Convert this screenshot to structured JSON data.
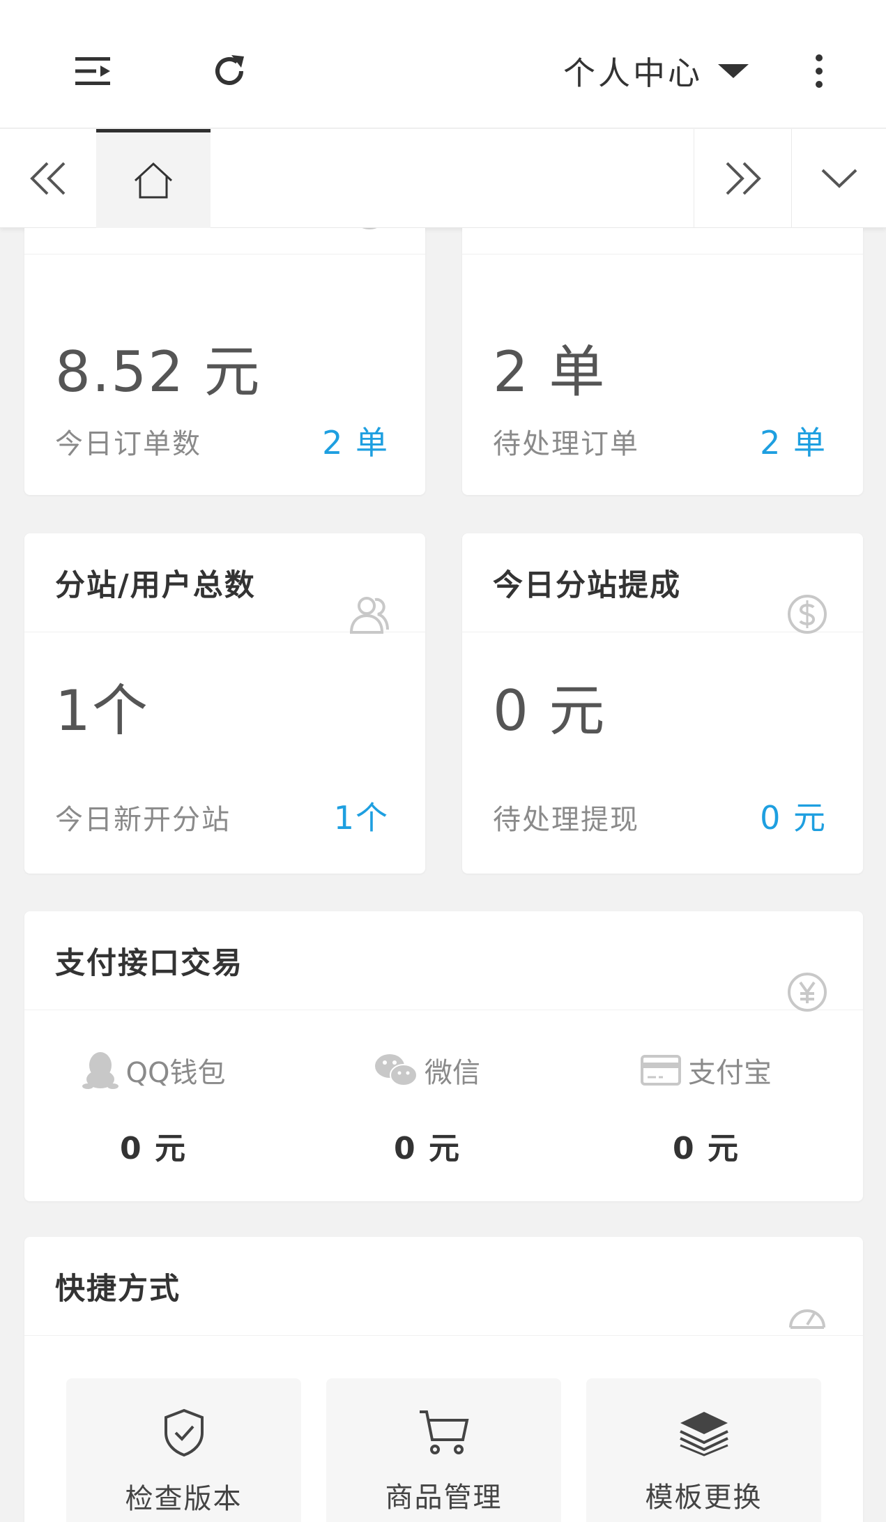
{
  "header": {
    "user_menu_label": "个人中心"
  },
  "cards": {
    "today_revenue": {
      "value": "8.52 元",
      "sub_label": "今日订单数",
      "sub_value": "2 单"
    },
    "orders": {
      "value": "2 单",
      "sub_label": "待处理订单",
      "sub_value": "2 单"
    },
    "substation_users": {
      "title": "分站/用户总数",
      "value": "1个",
      "sub_label": "今日新开分站",
      "sub_value": "1个"
    },
    "substation_commission": {
      "title": "今日分站提成",
      "value": "0 元",
      "sub_label": "待处理提现",
      "sub_value": "0 元"
    }
  },
  "payment": {
    "title": "支付接口交易",
    "items": [
      {
        "label": "QQ钱包",
        "value": "0 元"
      },
      {
        "label": "微信",
        "value": "0 元"
      },
      {
        "label": "支付宝",
        "value": "0 元"
      }
    ]
  },
  "shortcuts": {
    "title": "快捷方式",
    "items": [
      {
        "label": "检查版本"
      },
      {
        "label": "商品管理"
      },
      {
        "label": "模板更换"
      }
    ]
  },
  "colors": {
    "accent": "#1e9fe0",
    "icon_gray": "#c8c8c8"
  }
}
